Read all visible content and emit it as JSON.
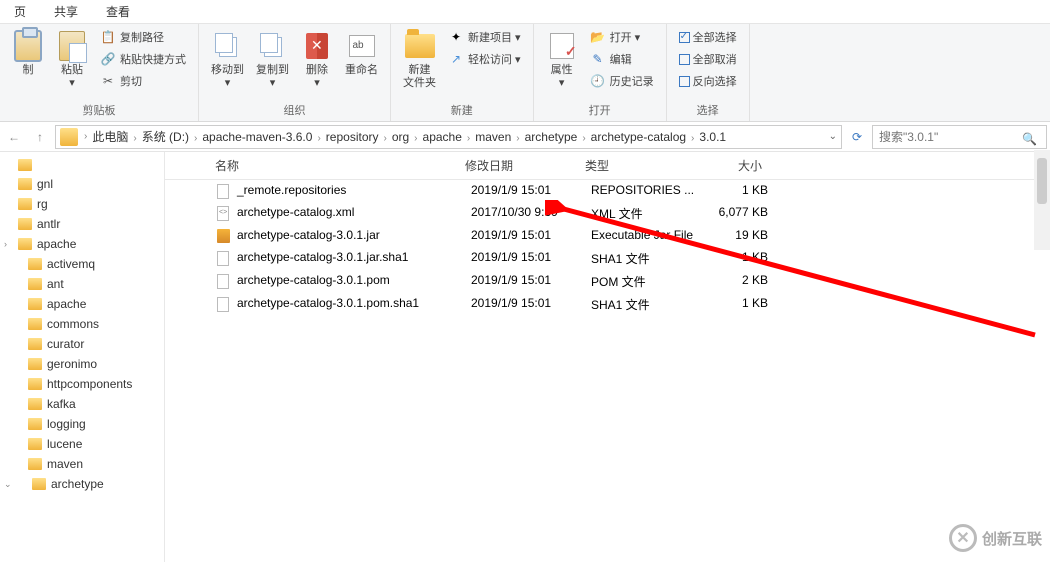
{
  "tabs": {
    "t0": "页",
    "t1": "共享",
    "t2": "查看"
  },
  "ribbon": {
    "clipboard": {
      "copy_btn": "制",
      "paste": "粘贴",
      "drop": "▾",
      "cut_icon": "✂",
      "cut": "剪切",
      "copy_path": "复制路径",
      "paste_shortcut": "粘贴快捷方式",
      "label": "剪贴板"
    },
    "organize": {
      "move": "移动到",
      "copy": "复制到",
      "delete": "删除",
      "rename": "重命名",
      "label": "组织"
    },
    "new": {
      "folder": "新建\n文件夹",
      "item": "新建项目 ▾",
      "easy": "轻松访问 ▾",
      "label": "新建"
    },
    "open": {
      "props": "属性",
      "open": "打开 ▾",
      "edit": "编辑",
      "history": "历史记录",
      "label": "打开"
    },
    "select": {
      "all": "全部选择",
      "none": "全部取消",
      "invert": "反向选择",
      "label": "选择"
    }
  },
  "breadcrumb": [
    "此电脑",
    "系统 (D:)",
    "apache-maven-3.6.0",
    "repository",
    "org",
    "apache",
    "maven",
    "archetype",
    "archetype-catalog",
    "3.0.1"
  ],
  "search_placeholder": "搜索\"3.0.1\"",
  "tree": [
    "",
    "gnl",
    "rg",
    "antlr",
    "apache",
    "activemq",
    "ant",
    "apache",
    "commons",
    "curator",
    "geronimo",
    "httpcomponents",
    "kafka",
    "logging",
    "lucene",
    "maven",
    "archetype"
  ],
  "columns": {
    "name": "名称",
    "date": "修改日期",
    "type": "类型",
    "size": "大小"
  },
  "files": [
    {
      "icon": "file",
      "name": "_remote.repositories",
      "date": "2019/1/9 15:01",
      "type": "REPOSITORIES ...",
      "size": "1 KB"
    },
    {
      "icon": "xml",
      "name": "archetype-catalog.xml",
      "date": "2017/10/30 9:39",
      "type": "XML 文件",
      "size": "6,077 KB"
    },
    {
      "icon": "jar",
      "name": "archetype-catalog-3.0.1.jar",
      "date": "2019/1/9 15:01",
      "type": "Executable Jar File",
      "size": "19 KB"
    },
    {
      "icon": "file",
      "name": "archetype-catalog-3.0.1.jar.sha1",
      "date": "2019/1/9 15:01",
      "type": "SHA1 文件",
      "size": "1 KB"
    },
    {
      "icon": "file",
      "name": "archetype-catalog-3.0.1.pom",
      "date": "2019/1/9 15:01",
      "type": "POM 文件",
      "size": "2 KB"
    },
    {
      "icon": "file",
      "name": "archetype-catalog-3.0.1.pom.sha1",
      "date": "2019/1/9 15:01",
      "type": "SHA1 文件",
      "size": "1 KB"
    }
  ],
  "watermark": "创新互联"
}
